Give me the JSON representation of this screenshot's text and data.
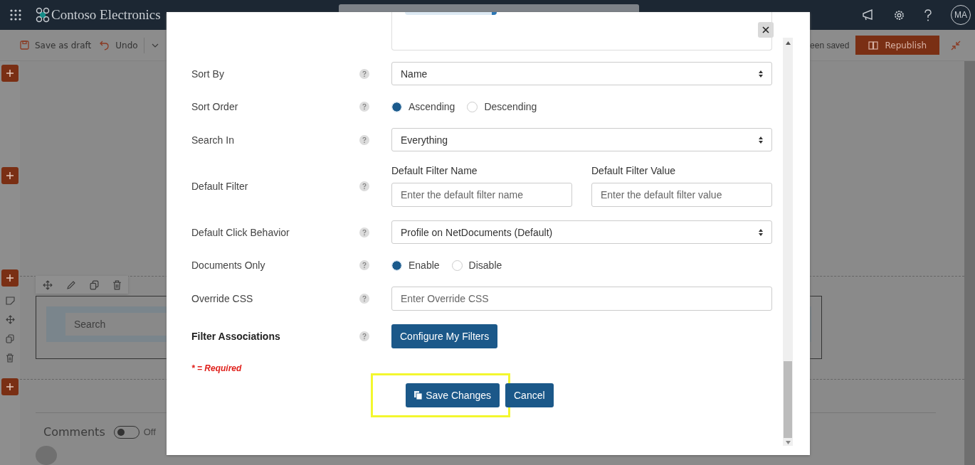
{
  "top_bar": {
    "site_name": "Contoso Electronics",
    "avatar": "MA"
  },
  "command_bar": {
    "items": [
      {
        "label": "Save as draft",
        "kind": "save"
      },
      {
        "label": "Undo",
        "kind": "undo"
      }
    ],
    "status": "een saved",
    "publish_button": "Republish"
  },
  "canvas": {
    "search": {
      "placeholder": "Search"
    },
    "comments": {
      "label": "Comments",
      "on": false,
      "state_label": "Off"
    }
  },
  "dialog": {
    "rows": [
      {
        "label": "Sort By",
        "kind": "select",
        "value": "Name"
      },
      {
        "label": "Sort Order",
        "kind": "radio",
        "options": [
          {
            "label": "Ascending",
            "selected": true
          },
          {
            "label": "Descending",
            "selected": false
          }
        ]
      },
      {
        "label": "Search In",
        "kind": "select",
        "value": "Everything"
      },
      {
        "label": "Default Filter",
        "kind": "dual-input",
        "fields": [
          {
            "heading": "Default Filter Name",
            "placeholder": "Enter the default filter name"
          },
          {
            "heading": "Default Filter Value",
            "placeholder": "Enter the default filter value"
          }
        ]
      },
      {
        "label": "Default Click Behavior",
        "kind": "select",
        "value": "Profile on NetDocuments (Default)"
      },
      {
        "label": "Documents Only",
        "kind": "radio",
        "options": [
          {
            "label": "Enable",
            "selected": true
          },
          {
            "label": "Disable",
            "selected": false
          }
        ]
      },
      {
        "label": "Override CSS",
        "kind": "input",
        "placeholder": "Enter Override CSS"
      },
      {
        "label": "Filter Associations",
        "kind": "button",
        "bold": true,
        "button": "Configure My Filters"
      }
    ],
    "required_note": "* = Required",
    "buttons": [
      {
        "label": "Save Changes",
        "kind": "save",
        "highlighted": true
      },
      {
        "label": "Cancel",
        "kind": "plain",
        "highlighted": false
      }
    ]
  }
}
